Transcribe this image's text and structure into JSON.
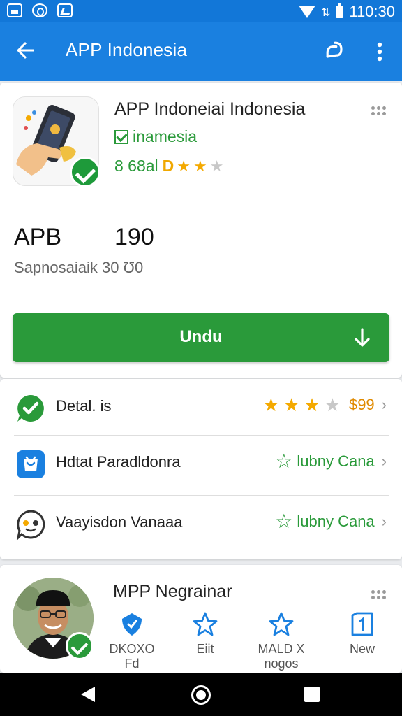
{
  "status_bar": {
    "time": "110:30"
  },
  "app_bar": {
    "title": "APP Indonesia"
  },
  "app": {
    "name": "APP Indoneiai Indonesia",
    "developer": "inamesia",
    "rating_text": "8 68al",
    "rating_glyph": "D",
    "stars": 2.5,
    "size_label": "APB",
    "size_value": "190",
    "subtitle": "Sapnosaiaik 30 Ʊ0",
    "download_label": "Undu"
  },
  "list": {
    "rows": [
      {
        "label": "Detal. is",
        "right_text": "$99",
        "icon": "whatsapp-icon",
        "stars": 3.5
      },
      {
        "label": "Hdtat Paradldonra",
        "right_text": "lubny Cana",
        "icon": "shop-bag-icon"
      },
      {
        "label": "Vaayisdon Vanaaa",
        "right_text": "lubny Cana",
        "icon": "chat-face-icon"
      }
    ]
  },
  "bottom_card": {
    "title": "ΜPP Negrainar",
    "actions": [
      {
        "label": "DKOXO\nFd",
        "icon": "shield-icon"
      },
      {
        "label": "Eiit",
        "icon": "star-outline-icon"
      },
      {
        "label": "MALD X\nnogos",
        "icon": "star-outline-icon"
      },
      {
        "label": "New",
        "icon": "bookmark-new-icon"
      }
    ]
  },
  "colors": {
    "primary": "#1a80e0",
    "status_bar": "#1277d8",
    "green": "#2a9a3a",
    "star_gold": "#f4a900",
    "price_orange": "#e08a00"
  }
}
